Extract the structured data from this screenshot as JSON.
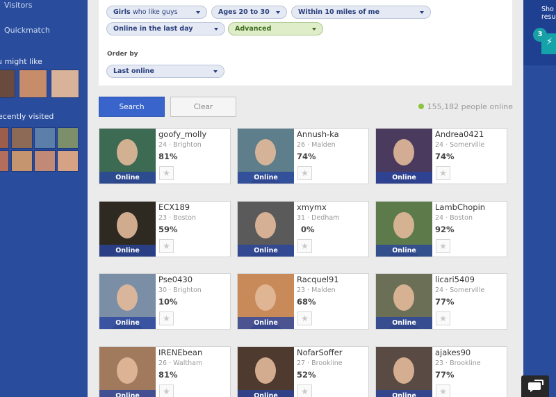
{
  "sidebar": {
    "visitors_label": "Visitors",
    "quickmatch_label": "Quickmatch",
    "might_like_heading": "u might like",
    "recently_visited_heading": "ecently visited",
    "might_like_colors": [
      "#6a4a3e",
      "#c78d6a",
      "#d9b399"
    ],
    "recent_colors": [
      "#9c5d4a",
      "#8c6a55",
      "#5b7fa8",
      "#7c8e6a",
      "#b46e5e",
      "#c4956e",
      "#c18a76",
      "#d6a286",
      "#c7846e"
    ]
  },
  "filters": {
    "gender": {
      "bold": "Girls",
      "lite": "who like guys"
    },
    "age": "Ages 20 to 30",
    "distance": "Within 10 miles of me",
    "online": "Online in the last day",
    "advanced": "Advanced",
    "order_by_label": "Order by",
    "order_by_value": "Last online"
  },
  "actions": {
    "search_label": "Search",
    "clear_label": "Clear",
    "online_count": "155,182 people online"
  },
  "cards": [
    {
      "username": "goofy_molly",
      "meta": "24 · Brighton",
      "match": "81%",
      "status": "Online",
      "color": "#3c6a52"
    },
    {
      "username": "Annush-ka",
      "meta": "26 · Malden",
      "match": "74%",
      "status": "Online",
      "color": "#5d7e8a"
    },
    {
      "username": "Andrea0421",
      "meta": "24 · Somerville",
      "match": "74%",
      "status": "Online",
      "color": "#4a3a5e"
    },
    {
      "username": "ECX189",
      "meta": "23 · Boston",
      "match": "59%",
      "status": "Online",
      "color": "#2e2a22"
    },
    {
      "username": "xmymx",
      "meta": "31 · Dedham",
      "match": "0%",
      "status": "Online",
      "color": "#5a5a5a"
    },
    {
      "username": "LambChopin",
      "meta": "24 · Boston",
      "match": "92%",
      "status": "Online",
      "color": "#5d7a4a"
    },
    {
      "username": "Pse0430",
      "meta": "30 · Brighton",
      "match": "10%",
      "status": "Online",
      "color": "#7a8ea6"
    },
    {
      "username": "Racquel91",
      "meta": "23 · Malden",
      "match": "68%",
      "status": "Online",
      "color": "#c98a5a"
    },
    {
      "username": "licari5409",
      "meta": "24 · Somerville",
      "match": "77%",
      "status": "Online",
      "color": "#6b6f56"
    },
    {
      "username": "IRENEbean",
      "meta": "26 · Waltham",
      "match": "81%",
      "status": "Online",
      "color": "#a17a5e"
    },
    {
      "username": "NofarSoffer",
      "meta": "27 · Brookline",
      "match": "52%",
      "status": "Online",
      "color": "#4e3a2e"
    },
    {
      "username": "ajakes90",
      "meta": "23 · Brookline",
      "match": "77%",
      "status": "Online",
      "color": "#5a4a44"
    }
  ],
  "right_panel": {
    "promo_text_1": "Sho",
    "promo_text_2": "resu",
    "badge_count": "3"
  },
  "colors": {
    "sidebar": "#294c9c",
    "primary_button": "#3864cc",
    "online_dot": "#8cc43c"
  }
}
